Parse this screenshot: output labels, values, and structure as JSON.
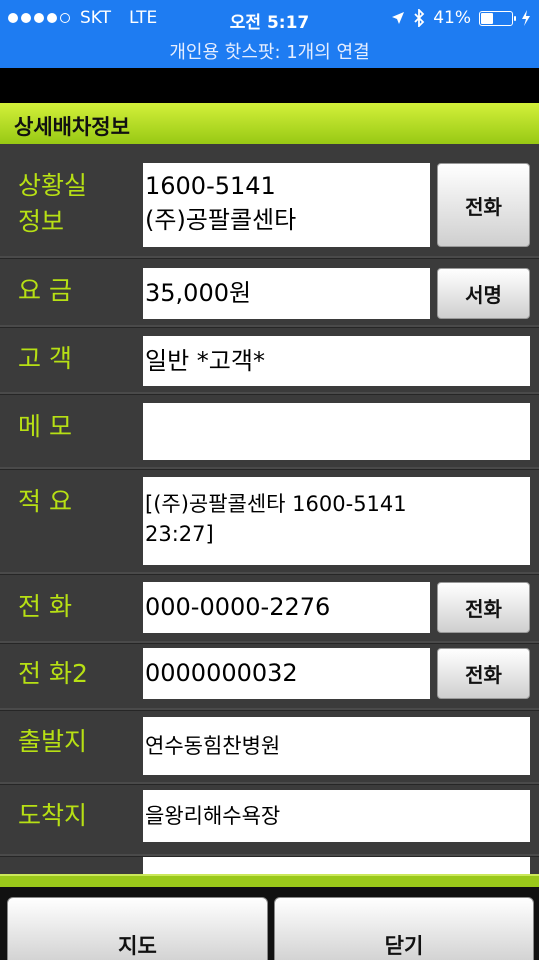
{
  "status_bar": {
    "carrier": "SKT",
    "network": "LTE",
    "time": "오전 5:17",
    "battery_percent": "41%",
    "battery_level": 0.41,
    "hotspot_text": "개인용 핫스팟: 1개의 연결"
  },
  "header": {
    "title": "상세배차정보"
  },
  "rows": {
    "office": {
      "label": "상황실\n정보",
      "value": "1600-5141\n(주)공팔콜센타",
      "button": "전화"
    },
    "fee": {
      "label": "요 금",
      "value": "35,000원",
      "button": "서명"
    },
    "customer": {
      "label": "고 객",
      "value": "일반 *고객*"
    },
    "memo": {
      "label": "메 모",
      "value": ""
    },
    "summary": {
      "label": "적 요",
      "value": "[(주)공팔콜센타  1600-5141\n23:27]"
    },
    "phone": {
      "label": "전 화",
      "value": "000-0000-2276",
      "button": "전화"
    },
    "phone2": {
      "label": "전 화2",
      "value": "0000000032",
      "button": "전화"
    },
    "departure": {
      "label": "출발지",
      "value": "연수동힘찬병원"
    },
    "destination": {
      "label": "도착지",
      "value": "을왕리해수욕장"
    }
  },
  "bottom": {
    "map_button": "지도",
    "close_button": "닫기"
  }
}
